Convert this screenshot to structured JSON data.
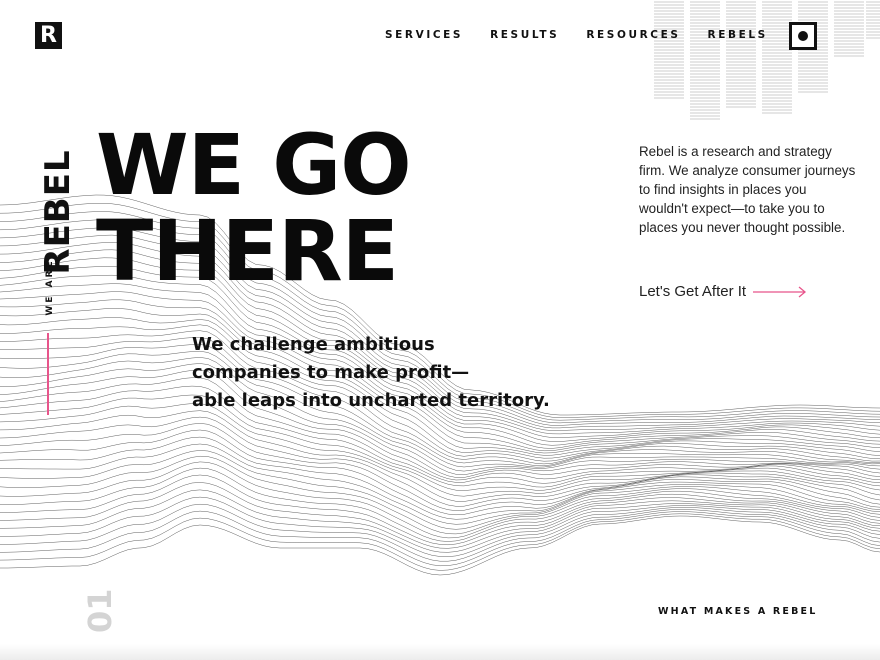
{
  "brand": {
    "logo_letter": "R"
  },
  "nav": {
    "items": [
      {
        "label": "SERVICES"
      },
      {
        "label": "RESULTS"
      },
      {
        "label": "RESOURCES"
      },
      {
        "label": "REBELS"
      }
    ]
  },
  "menu": {
    "icon": "menu-dot-icon"
  },
  "side_tag": {
    "prefix": "WE ARE",
    "word": "REBEL"
  },
  "hero": {
    "headline_line1": "WE GO",
    "headline_line2": "THERE",
    "lead_line1": "We challenge ambitious",
    "lead_line2": "companies to make profit—",
    "lead_line3": "able leaps into uncharted territory."
  },
  "about": {
    "line1": "Rebel is a research and strategy",
    "line2": "firm. We analyze consumer journeys",
    "line3": "to find insights in places you",
    "line4": "wouldn't expect—to take you to",
    "line5": "places you never thought possible.",
    "cta_label": "Let's Get After It",
    "cta_icon": "arrow-right-icon"
  },
  "section": {
    "number": "01",
    "link_label": "WHAT MAKES A REBEL"
  },
  "colors": {
    "accent": "#e8558b",
    "ink": "#111111",
    "muted": "#d4d4d4"
  }
}
